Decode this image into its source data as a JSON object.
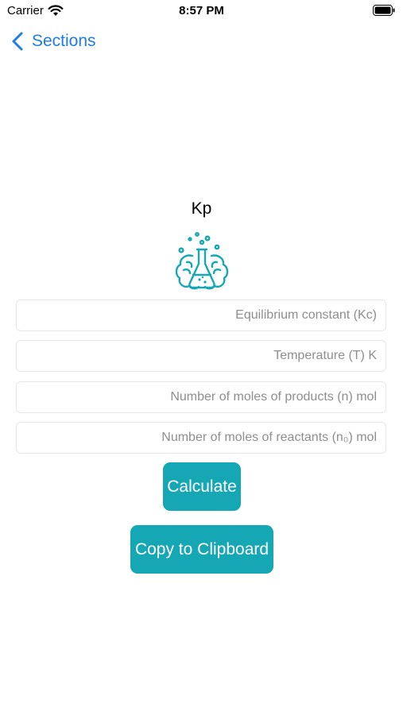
{
  "status_bar": {
    "carrier": "Carrier",
    "time": "8:57 PM"
  },
  "nav": {
    "back_label": "Sections"
  },
  "page": {
    "title": "Kp",
    "logo_icon": "flask-brain-icon"
  },
  "fields": {
    "kc_placeholder": "Equilibrium constant (Kc)",
    "temperature_placeholder": "Temperature (T) K",
    "products_placeholder": "Number of moles of products (n) mol",
    "reactants_placeholder": "Number of moles of reactants (n₀) mol"
  },
  "buttons": {
    "calculate_label": "Calculate",
    "copy_label": "Copy to Clipboard"
  },
  "colors": {
    "accent": "#16a7b5",
    "link": "#1e7ce6"
  }
}
